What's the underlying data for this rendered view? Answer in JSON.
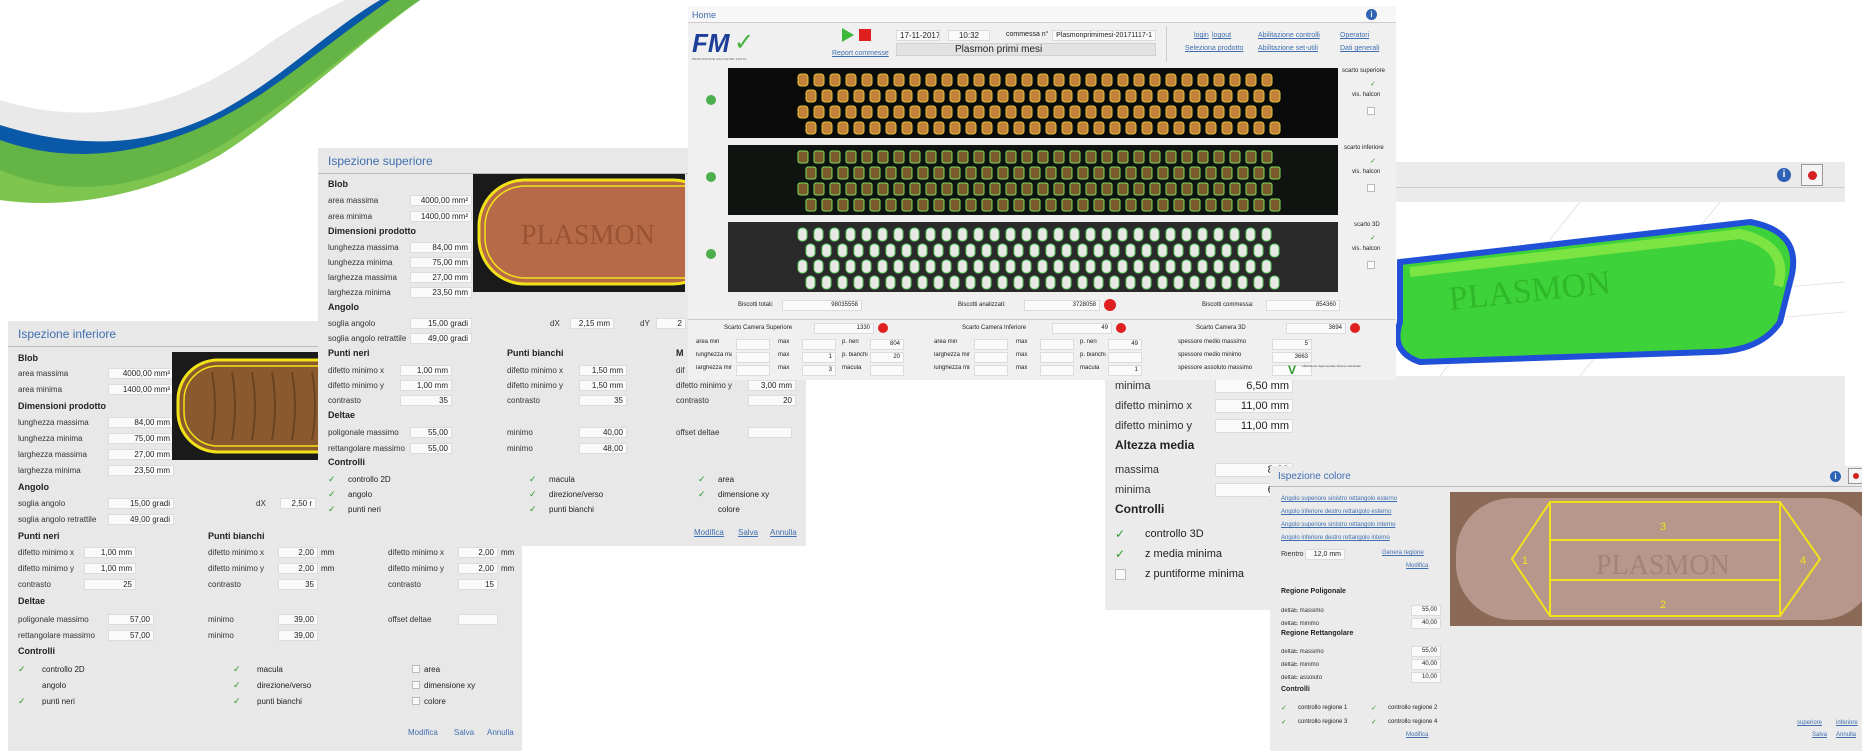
{
  "inferiore": {
    "title": "Ispezione inferiore",
    "blob": {
      "title": "Blob",
      "items": [
        {
          "label": "area massima",
          "value": "4000,00 mm²"
        },
        {
          "label": "area minima",
          "value": "1400,00 mm²"
        }
      ]
    },
    "dim": {
      "title": "Dimensioni prodotto",
      "items": [
        {
          "label": "lunghezza massima",
          "value": "84,00 mm"
        },
        {
          "label": "lunghezza minima",
          "value": "75,00 mm"
        },
        {
          "label": "larghezza massima",
          "value": "27,00 mm"
        },
        {
          "label": "larghezza minima",
          "value": "23,50 mm"
        }
      ]
    },
    "angolo": {
      "title": "Angolo",
      "items": [
        {
          "label": "soglia angolo",
          "value": "15,00 gradi"
        },
        {
          "label": "soglia angolo retrattile",
          "value": "49,00 gradi"
        }
      ],
      "dx_label": "dX",
      "dx_value": "2,50 r"
    },
    "neri": {
      "title": "Punti neri",
      "items": [
        {
          "label": "difetto minimo x",
          "value": "1,00 mm"
        },
        {
          "label": "difetto minimo y",
          "value": "1,00 mm"
        },
        {
          "label": "contrasto",
          "value": "25"
        }
      ]
    },
    "bianchi": {
      "title": "Punti bianchi",
      "items": [
        {
          "label": "difetto minimo x",
          "value": "2,00",
          "unit": "mm"
        },
        {
          "label": "difetto minimo y",
          "value": "2,00",
          "unit": "mm"
        },
        {
          "label": "contrasto",
          "value": "35",
          "unit": ""
        }
      ]
    },
    "m": {
      "items": [
        {
          "label": "difetto minimo x",
          "value": "2,00",
          "unit": "mm"
        },
        {
          "label": "difetto minimo y",
          "value": "2,00",
          "unit": "mm"
        },
        {
          "label": "contrasto",
          "value": "15",
          "unit": ""
        }
      ]
    },
    "deltae": {
      "title": "Deltae",
      "items": [
        {
          "label": "poligonale massimo",
          "value": "57,00"
        },
        {
          "label": "rettangolare massimo",
          "value": "57,00"
        }
      ],
      "min": [
        {
          "label": "minimo",
          "value": "39,00"
        },
        {
          "label": "minimo",
          "value": "39,00"
        }
      ],
      "offset_label": "offset deltae",
      "offset_value": ""
    },
    "controlli": {
      "title": "Controlli",
      "items": [
        {
          "label": "controllo 2D",
          "checked": true
        },
        {
          "label": "angolo",
          "checked": false
        },
        {
          "label": "punti neri",
          "checked": true
        },
        {
          "label": "macula",
          "checked": true
        },
        {
          "label": "direzione/verso",
          "checked": true
        },
        {
          "label": "punti bianchi",
          "checked": true
        },
        {
          "label": "area",
          "checked": false
        },
        {
          "label": "dimensione xy",
          "checked": false
        },
        {
          "label": "colore",
          "checked": false
        }
      ]
    },
    "actions": {
      "modifica": "Modifica",
      "salva": "Salva",
      "annulla": "Annulla"
    }
  },
  "superiore": {
    "title": "Ispezione superiore",
    "blob": {
      "title": "Blob",
      "items": [
        {
          "label": "area massima",
          "value": "4000,00 mm²"
        },
        {
          "label": "area minima",
          "value": "1400,00 mm²"
        }
      ]
    },
    "dim": {
      "title": "Dimensioni prodotto",
      "items": [
        {
          "label": "lunghezza massima",
          "value": "84,00 mm"
        },
        {
          "label": "lunghezza minima",
          "value": "75,00 mm"
        },
        {
          "label": "larghezza massima",
          "value": "27,00 mm"
        },
        {
          "label": "larghezza minima",
          "value": "23,50 mm"
        }
      ]
    },
    "angolo": {
      "title": "Angolo",
      "items": [
        {
          "label": "soglia angolo",
          "value": "15,00 gradi"
        },
        {
          "label": "soglia angolo retrattile",
          "value": "49,00 gradi"
        }
      ],
      "dx_label": "dX",
      "dx_value": "2,15 mm",
      "dy_label": "dY",
      "dy_value": "2"
    },
    "neri": {
      "title": "Punti neri",
      "items": [
        {
          "label": "difetto minimo x",
          "value": "1,00 mm"
        },
        {
          "label": "difetto minimo y",
          "value": "1,00 mm"
        },
        {
          "label": "contrasto",
          "value": "35"
        }
      ]
    },
    "bianchi": {
      "title": "Punti bianchi",
      "items": [
        {
          "label": "difetto minimo x",
          "value": "1,50 mm"
        },
        {
          "label": "difetto minimo y",
          "value": "1,50 mm"
        },
        {
          "label": "contrasto",
          "value": "35"
        }
      ]
    },
    "m": {
      "title": "M",
      "items": [
        {
          "label": "dif",
          "value": ""
        },
        {
          "label": "difetto minimo y",
          "value": "3,00 mm"
        },
        {
          "label": "contrasto",
          "value": "20"
        }
      ]
    },
    "deltae": {
      "title": "Deltae",
      "items": [
        {
          "label": "poligonale massimo",
          "value": "55,00"
        },
        {
          "label": "rettangolare massimo",
          "value": "55,00"
        }
      ],
      "min": [
        {
          "label": "minimo",
          "value": "40,00"
        },
        {
          "label": "minimo",
          "value": "48,00"
        }
      ],
      "offset_label": "offset deltae",
      "offset_value": ""
    },
    "controlli": {
      "title": "Controlli",
      "items": [
        {
          "label": "controllo 2D",
          "checked": true
        },
        {
          "label": "angolo",
          "checked": true
        },
        {
          "label": "punti neri",
          "checked": true
        },
        {
          "label": "macula",
          "checked": true
        },
        {
          "label": "direzione/verso",
          "checked": true
        },
        {
          "label": "punti bianchi",
          "checked": true
        },
        {
          "label": "area",
          "checked": true
        },
        {
          "label": "dimensione xy",
          "checked": true
        },
        {
          "label": "colore",
          "checked": false
        }
      ]
    },
    "actions": {
      "modifica": "Modifica",
      "salva": "Salva",
      "annulla": "Annulla"
    }
  },
  "home": {
    "title": "Home",
    "logo": "FM",
    "logo_sub": "PRODUZIONE  MACCHINE  PASTA",
    "date": "17-11-2017",
    "time": "10:32",
    "commessa_label": "commessa n°",
    "commessa_value": "Plasmonprimimesi-20171117-1",
    "product": "Plasmon primi mesi",
    "report": "Report commesse",
    "links": [
      "login",
      "logout",
      "Abilitazione controlli",
      "Operatori",
      "Seleziona prodotto",
      "Abilitazione set-utili",
      "Dati generali"
    ],
    "side": [
      {
        "title": "scarto superiore",
        "label": "vis. halcon"
      },
      {
        "title": "scarto inferiore",
        "label": "vis. halcon"
      },
      {
        "title": "scarto 3D",
        "label": "vis. halcon"
      }
    ],
    "totals": [
      {
        "label": "Biscotti totali:",
        "value": "98035558"
      },
      {
        "label": "Biscotti analizzati:",
        "value": "3728058"
      },
      {
        "label": "Biscotti commessa:",
        "value": "854360"
      }
    ],
    "scarti": [
      {
        "label": "Scarto Camera Superiore",
        "value": "1330",
        "rows": [
          [
            "area min",
            "",
            "max",
            "",
            "p. neri",
            "804"
          ],
          [
            "lunghezza max",
            "",
            "max",
            "1",
            "p. bianchi",
            "20"
          ],
          [
            "larghezza min",
            "",
            "max",
            "3",
            "macula",
            ""
          ]
        ]
      },
      {
        "label": "Scarto Camera Inferiore",
        "value": "49",
        "rows": [
          [
            "area min",
            "",
            "max",
            "",
            "p. neri",
            "49"
          ],
          [
            "larghezza min",
            "",
            "max",
            "",
            "p. bianchi",
            ""
          ],
          [
            "lunghezza min",
            "",
            "max",
            "",
            "macula",
            "1"
          ]
        ]
      },
      {
        "label": "Scarto Camera 3D",
        "value": "3694",
        "rows": [
          [
            "spessore medio massimo",
            "5"
          ],
          [
            "spessore medio minimo",
            "3663"
          ],
          [
            "spessore assoluto massimo",
            ""
          ]
        ]
      }
    ],
    "vision_note": "Laboratorio Sperimentale Visione Industriale"
  },
  "panel3d": {
    "watermark": "PLASMON",
    "items": [
      {
        "label": "minima",
        "value": "6,50 mm"
      },
      {
        "label": "difetto minimo x",
        "value": "11,00 mm"
      },
      {
        "label": "difetto minimo y",
        "value": "11,00 mm"
      }
    ],
    "altezza": {
      "title": "Altezza media",
      "items": [
        {
          "label": "massima",
          "value": "8,60"
        },
        {
          "label": "minima",
          "value": "6,50"
        }
      ]
    },
    "controlli": {
      "title": "Controlli",
      "items": [
        {
          "label": "controllo 3D",
          "checked": true
        },
        {
          "label": "z media minima",
          "checked": true
        },
        {
          "label": "z puntiforme minima",
          "checked": false
        }
      ]
    }
  },
  "colore": {
    "title": "Ispezione colore",
    "links": [
      "Angolo superiore sinistro rettangolo esterno",
      "Angolo inferiore destro rettangolo esterno",
      "Angolo superiore sinistro rettangolo interno",
      "Angolo inferiore destro rettangolo interno"
    ],
    "rientro_label": "Rientro",
    "rientro_value": "12,0 mm",
    "genera": "Genera regione",
    "modifica": "Modifica",
    "poli": {
      "title": "Regione Poligonale",
      "items": [
        {
          "label": "deltaE massimo",
          "value": "55,00"
        },
        {
          "label": "deltaE minimo",
          "value": "40,00"
        }
      ]
    },
    "rett": {
      "title": "Regione Rettangolare",
      "items": [
        {
          "label": "deltaE massimo",
          "value": "55,00"
        },
        {
          "label": "deltaE minimo",
          "value": "40,00"
        },
        {
          "label": "deltaE assoluto",
          "value": "10,00"
        }
      ]
    },
    "controlli": {
      "title": "Controlli",
      "items": [
        {
          "label": "controllo regione 1",
          "checked": true
        },
        {
          "label": "controllo regione 2",
          "checked": true
        },
        {
          "label": "controllo regione 3",
          "checked": true
        },
        {
          "label": "controllo regione 4",
          "checked": true
        }
      ]
    },
    "regions": [
      "1",
      "2",
      "3",
      "4"
    ],
    "watermark": "PLASMON",
    "bottom_links": [
      "superiore",
      "inferiore",
      "Salva",
      "Annulla"
    ]
  },
  "colors": {
    "accent": "#3f6fb0",
    "check": "#2c9a2c",
    "highlight": "#f2e21a"
  }
}
